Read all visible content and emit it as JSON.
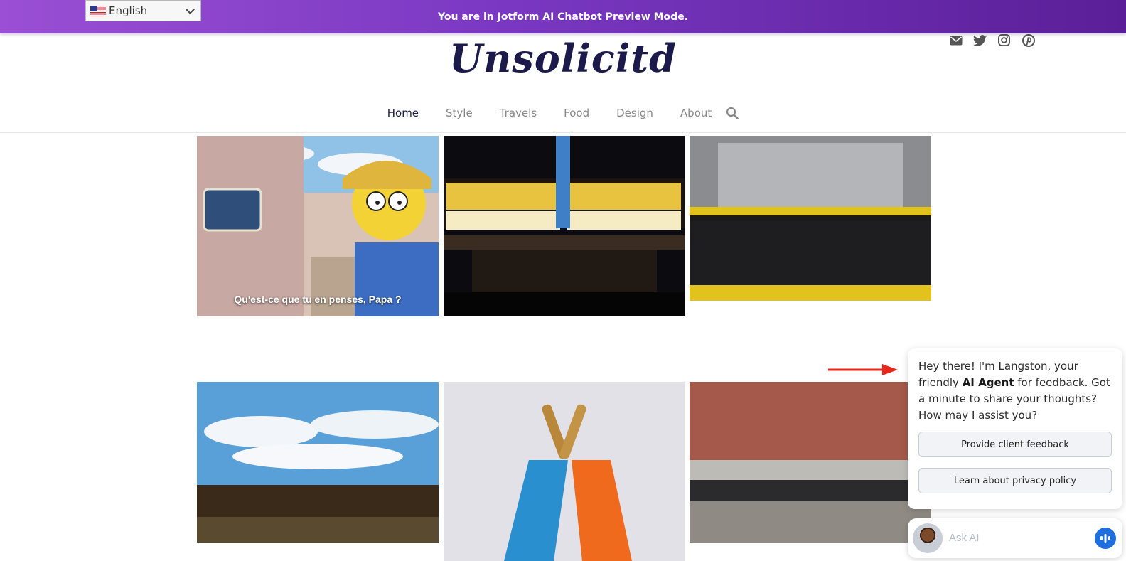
{
  "banner": {
    "text": "You are in Jotform AI Chatbot Preview Mode.",
    "language": "English"
  },
  "site": {
    "logo": "Unsolicitd",
    "social_icons": [
      "email-icon",
      "twitter-icon",
      "instagram-icon",
      "pinterest-icon"
    ]
  },
  "nav": {
    "items": [
      {
        "label": "Home",
        "active": true
      },
      {
        "label": "Style"
      },
      {
        "label": "Travels"
      },
      {
        "label": "Food"
      },
      {
        "label": "Design"
      },
      {
        "label": "About"
      }
    ],
    "search_icon": "search-icon"
  },
  "posts": [
    {
      "caption": "Qu'est-ce que tu en penses, Papa ?"
    },
    {
      "caption": ""
    },
    {
      "caption": ""
    },
    {
      "caption": ""
    },
    {
      "caption": ""
    },
    {
      "caption": ""
    }
  ],
  "chatbot": {
    "message_prefix": "Hey there! I'm Langston, your friendly",
    "message_bold": "AI Agent",
    "message_suffix": "for feedback. Got a minute to share your thoughts? How may I assist you?",
    "buttons": [
      "Provide client feedback",
      "Learn about privacy policy"
    ],
    "input_placeholder": "Ask AI",
    "colors": {
      "accent": "#1f6fe0",
      "arrow": "#e8261b"
    }
  }
}
